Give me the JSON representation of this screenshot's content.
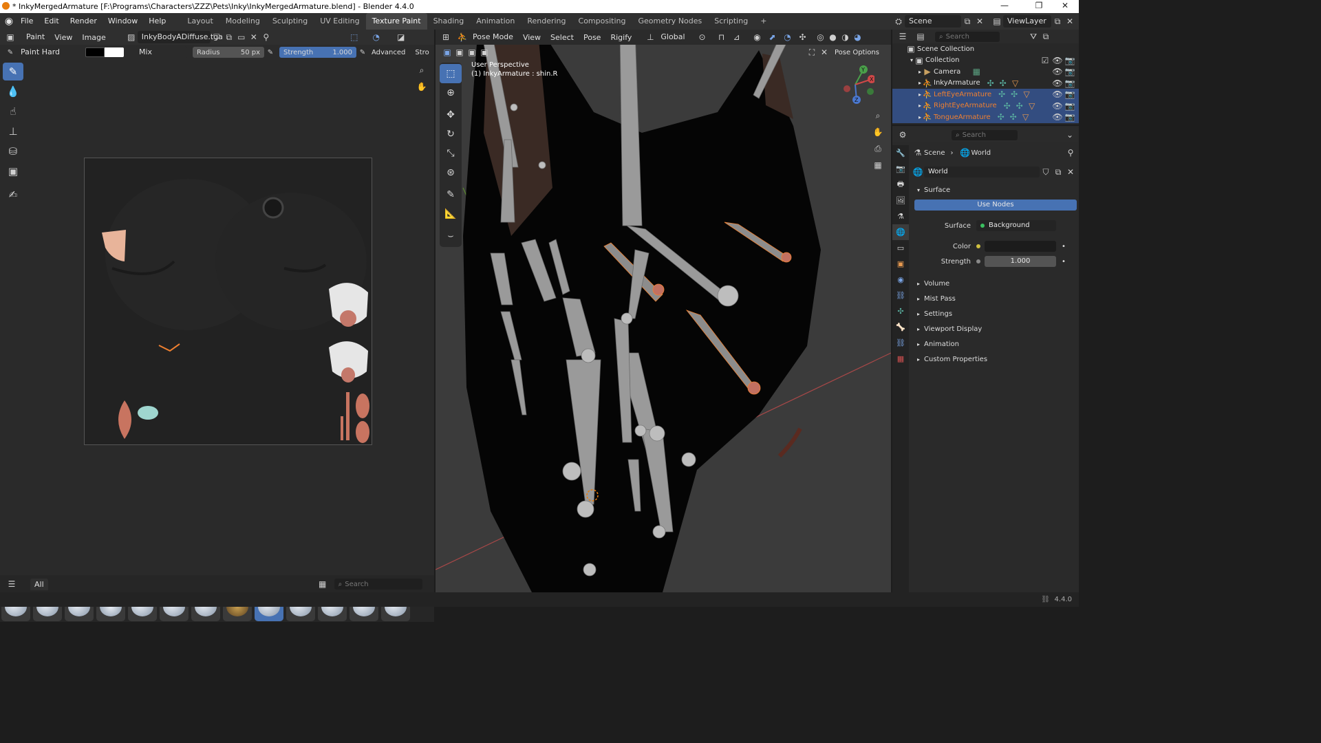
{
  "window": {
    "title": "* InkyMergedArmature [F:\\Programs\\Characters\\ZZZ\\Pets\\Inky\\InkyMergedArmature.blend] - Blender 4.4.0",
    "minimize": "—",
    "maximize": "❐",
    "close": "✕"
  },
  "menu": {
    "file": "File",
    "edit": "Edit",
    "render": "Render",
    "window": "Window",
    "help": "Help"
  },
  "workspaces": [
    "Layout",
    "Modeling",
    "Sculpting",
    "UV Editing",
    "Texture Paint",
    "Shading",
    "Animation",
    "Rendering",
    "Compositing",
    "Geometry Nodes",
    "Scripting"
  ],
  "active_workspace": "Texture Paint",
  "scene_selector": {
    "label": "Scene"
  },
  "viewlayer_selector": {
    "label": "ViewLayer"
  },
  "image_editor": {
    "mode": "Paint",
    "view_menu": "View",
    "image_menu": "Image",
    "image_name": "InkyBodyADiffuse.tga",
    "brush_name": "Paint Hard",
    "blend_mode": "Mix",
    "radius_label": "Radius",
    "radius_value": "50 px",
    "strength_label": "Strength",
    "strength_value": "1.000",
    "advanced": "Advanced",
    "stroke": "Stro",
    "primary_color": "#000000",
    "secondary_color": "#ffffff"
  },
  "asset_shelf": {
    "tab_all": "All",
    "search_placeholder": "Search",
    "brush_count": 13,
    "active_index": 8
  },
  "viewport": {
    "mode": "Pose Mode",
    "view_menu": "View",
    "select_menu": "Select",
    "pose_menu": "Pose",
    "rigify_menu": "Rigify",
    "orientation": "Global",
    "pose_options": "Pose Options",
    "perspective_label": "User Perspective",
    "active_object_label": "(1) InkyArmature : shin.R",
    "gizmo": {
      "x": "X",
      "y": "Y",
      "z": "Z"
    }
  },
  "outliner": {
    "search_placeholder": "Search",
    "root": "Scene Collection",
    "collection": "Collection",
    "items": [
      {
        "name": "Camera",
        "selected": false,
        "orange": false
      },
      {
        "name": "InkyArmature",
        "selected": false,
        "orange": false
      },
      {
        "name": "LeftEyeArmature",
        "selected": true,
        "orange": true
      },
      {
        "name": "RightEyeArmature",
        "selected": true,
        "orange": true
      },
      {
        "name": "TongueArmature",
        "selected": true,
        "orange": true
      }
    ]
  },
  "properties": {
    "search_placeholder": "Search",
    "breadcrumb_scene": "Scene",
    "breadcrumb_world": "World",
    "world_name": "World",
    "surface_panel": "Surface",
    "use_nodes": "Use Nodes",
    "surface_label": "Surface",
    "surface_value": "Background",
    "color_label": "Color",
    "strength_label": "Strength",
    "strength_value": "1.000",
    "panels": [
      "Volume",
      "Mist Pass",
      "Settings",
      "Viewport Display",
      "Animation",
      "Custom Properties"
    ]
  },
  "status": {
    "version": "4.4.0"
  },
  "colors": {
    "accent": "#4772b3",
    "selected_bone": "#f08030",
    "world_color": "#1c1c1c"
  }
}
